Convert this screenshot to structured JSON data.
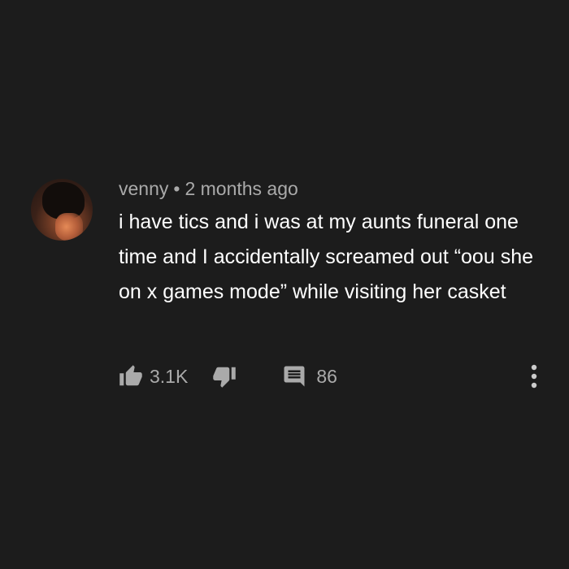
{
  "comment": {
    "author": "venny",
    "separator": "•",
    "time": "2 months ago",
    "text": "i have tics and i was at my aunts funeral one time and I accidentally screamed out “oou she on x games mode” while visiting her casket"
  },
  "actions": {
    "like_count": "3.1K",
    "reply_count": "86"
  },
  "icons": {
    "like": "thumbs-up-icon",
    "dislike": "thumbs-down-icon",
    "reply": "comment-icon",
    "more": "more-vertical-icon"
  },
  "colors": {
    "background": "#1c1c1c",
    "text_primary": "#ffffff",
    "text_secondary": "#aaaaaa"
  }
}
